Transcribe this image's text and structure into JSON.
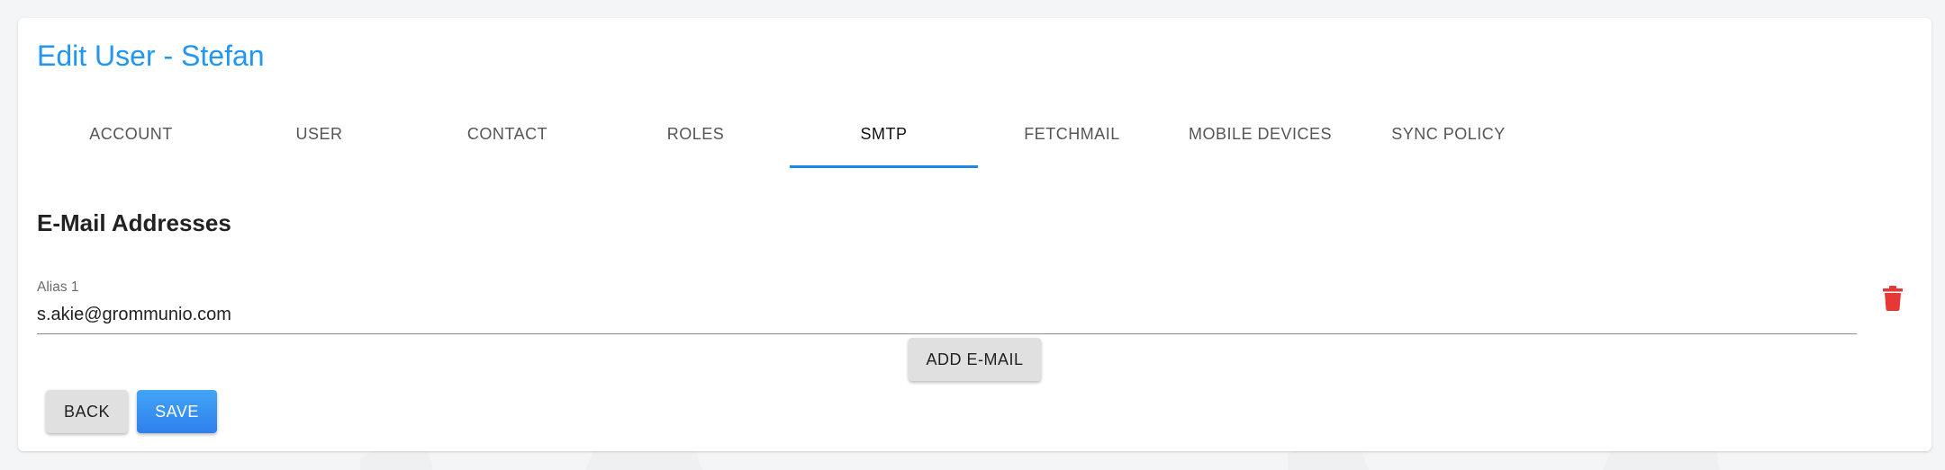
{
  "page": {
    "title": "Edit User - Stefan"
  },
  "tabs": [
    {
      "label": "ACCOUNT",
      "active": false
    },
    {
      "label": "USER",
      "active": false
    },
    {
      "label": "CONTACT",
      "active": false
    },
    {
      "label": "ROLES",
      "active": false
    },
    {
      "label": "SMTP",
      "active": true
    },
    {
      "label": "FETCHMAIL",
      "active": false
    },
    {
      "label": "MOBILE DEVICES",
      "active": false
    },
    {
      "label": "SYNC POLICY",
      "active": false
    }
  ],
  "section": {
    "title": "E-Mail Addresses"
  },
  "aliases": [
    {
      "label": "Alias 1",
      "value": "s.akie@grommunio.com",
      "delete_icon": "trash-icon"
    }
  ],
  "actions": {
    "add_email_label": "ADD E-MAIL",
    "back_label": "BACK",
    "save_label": "SAVE"
  },
  "colors": {
    "accent": "#2196f3",
    "tab_indicator": "#1e88e5",
    "delete": "#e53935",
    "save_button": "#3b8ff0"
  }
}
